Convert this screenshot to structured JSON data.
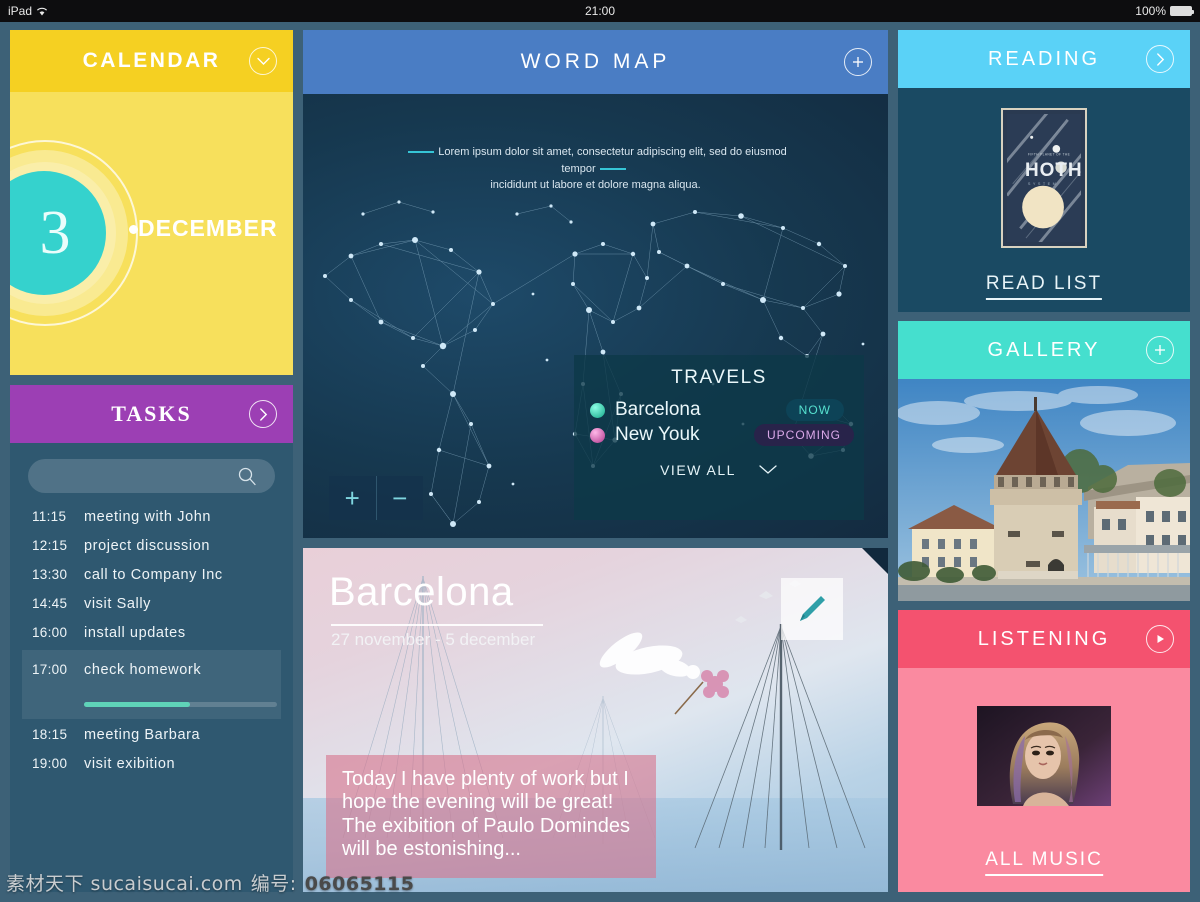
{
  "statusbar": {
    "device": "iPad",
    "time": "21:00",
    "battery": "100%"
  },
  "calendar": {
    "title": "CALENDAR",
    "day": "3",
    "month": "DECEMBER",
    "icon": "chevron-down-circle-icon"
  },
  "tasks": {
    "title": "TASKS",
    "icon": "chevron-right-circle-icon",
    "search_placeholder": "",
    "search_value": "",
    "items": [
      {
        "time": "11:15",
        "label": "meeting with John",
        "active": false
      },
      {
        "time": "12:15",
        "label": "project discussion",
        "active": false
      },
      {
        "time": "13:30",
        "label": "call to Company Inc",
        "active": false
      },
      {
        "time": "14:45",
        "label": "visit Sally",
        "active": false
      },
      {
        "time": "16:00",
        "label": "install updates",
        "active": false
      },
      {
        "time": "17:00",
        "label": "check homework",
        "active": true,
        "progress": 55
      },
      {
        "time": "18:15",
        "label": "meeting Barbara",
        "active": false
      },
      {
        "time": "19:00",
        "label": "visit exibition",
        "active": false
      }
    ]
  },
  "wordmap": {
    "title": "WORD  MAP",
    "icon": "plus-circle-icon",
    "caption_line1": "Lorem ipsum dolor sit amet, consectetur adipiscing elit, sed do eiusmod tempor",
    "caption_line2": "incididunt ut labore et dolore magna aliqua.",
    "zoom_in": "+",
    "zoom_out": "−",
    "travels": {
      "title": "TRAVELS",
      "entries": [
        {
          "city": "Barcelona",
          "badge": "NOW",
          "state": "now"
        },
        {
          "city": "New Youk",
          "badge": "UPCOMING",
          "state": "upcoming"
        }
      ],
      "view_all": "VIEW ALL"
    }
  },
  "barcelona": {
    "title": "Barcelona",
    "dates": "27 november - 5 december",
    "edit_icon": "pencil-icon",
    "note": "Today I have plenty of work but I hope the evening will be great! The exibition of Paulo Domindes will be estonishing..."
  },
  "reading": {
    "title": "READING",
    "icon": "chevron-right-circle-icon",
    "poster": {
      "sub_top": "FIFTH PLANET OF THE",
      "title": "HOTH",
      "sub_bottom": "S Y S T E M"
    },
    "link": "READ LIST"
  },
  "gallery": {
    "title": "GALLERY",
    "icon": "plus-circle-icon",
    "photo_alt": "castle-tower-photo"
  },
  "listening": {
    "title": "LISTENING",
    "icon": "play-circle-icon",
    "album_alt": "album-artwork",
    "link": "ALL MUSIC"
  },
  "watermark": {
    "site": "素材天下 sucaisucai.com",
    "label": "编号:",
    "number": "06065115"
  },
  "colors": {
    "calendar_header": "#f5d022",
    "calendar_body": "#f7e05c",
    "tasks_header": "#9c3fb4",
    "wordmap_header": "#4a7dc4",
    "reading_header": "#5ad2f7",
    "gallery_header": "#45dfce",
    "listening_header": "#f4526f",
    "accent_teal": "#35d2cd",
    "page_bg": "#3d6177"
  }
}
